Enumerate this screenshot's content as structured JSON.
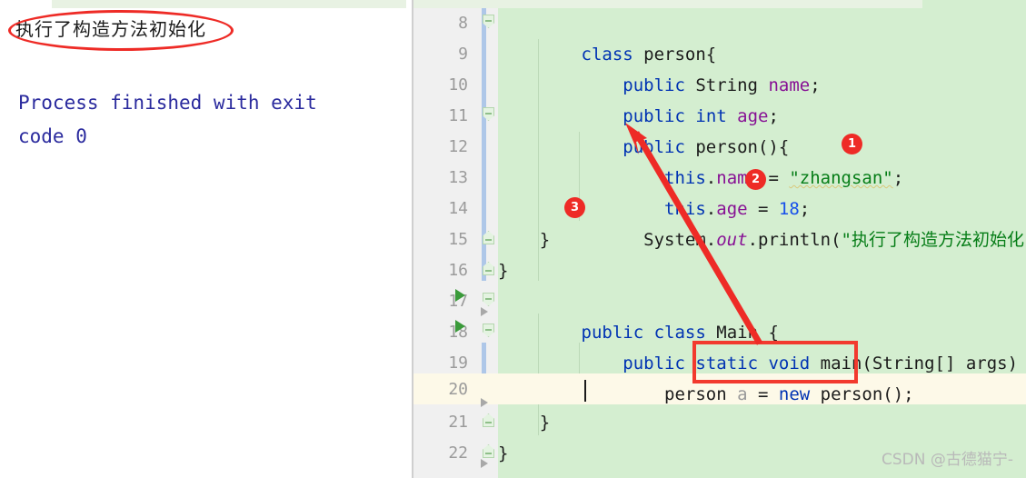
{
  "console": {
    "output_chinese": "执行了构造方法初始化",
    "exit_line1": "Process finished with exit",
    "exit_line2": "code 0"
  },
  "annotations": {
    "ellipse_label": "ellipse-highlight-console-output",
    "badge1": "1",
    "badge2": "2",
    "badge3": "3",
    "redbox_label": "red-box-new-person",
    "arrow_label": "red-arrow-pointing-to-constructor",
    "accent_red": "#ee2b26",
    "box_red": "#f23a2e"
  },
  "editor": {
    "background": "#d4eed0",
    "gutter_background": "#f0f0f0",
    "caret_line_background": "#fdf9e8",
    "lines": [
      {
        "number": "8",
        "text": "class person{",
        "tokens": [
          {
            "t": "class",
            "c": "kw"
          },
          {
            "t": " ",
            "c": "plain"
          },
          {
            "t": "person{",
            "c": "plain"
          }
        ]
      },
      {
        "number": "9",
        "text": "    public String name;",
        "tokens": [
          {
            "t": "    ",
            "c": "plain"
          },
          {
            "t": "public",
            "c": "kw"
          },
          {
            "t": " String ",
            "c": "plain"
          },
          {
            "t": "name",
            "c": "field"
          },
          {
            "t": ";",
            "c": "plain"
          }
        ]
      },
      {
        "number": "10",
        "text": "    public int age;",
        "tokens": [
          {
            "t": "    ",
            "c": "plain"
          },
          {
            "t": "public",
            "c": "kw"
          },
          {
            "t": " ",
            "c": "plain"
          },
          {
            "t": "int",
            "c": "kw"
          },
          {
            "t": " ",
            "c": "plain"
          },
          {
            "t": "age",
            "c": "field"
          },
          {
            "t": ";",
            "c": "plain"
          }
        ]
      },
      {
        "number": "11",
        "text": "    public person(){",
        "tokens": [
          {
            "t": "    ",
            "c": "plain"
          },
          {
            "t": "public",
            "c": "kw"
          },
          {
            "t": " person(){",
            "c": "plain"
          }
        ]
      },
      {
        "number": "12",
        "text": "        this.name = \"zhangsan\";",
        "tokens": [
          {
            "t": "        ",
            "c": "plain"
          },
          {
            "t": "this",
            "c": "kw"
          },
          {
            "t": ".",
            "c": "plain"
          },
          {
            "t": "name",
            "c": "field"
          },
          {
            "t": " = ",
            "c": "plain"
          },
          {
            "t": "\"zhangsan\"",
            "c": "str wavy"
          },
          {
            "t": ";",
            "c": "plain"
          }
        ]
      },
      {
        "number": "13",
        "text": "        this.age = 18;",
        "tokens": [
          {
            "t": "        ",
            "c": "plain"
          },
          {
            "t": "this",
            "c": "kw"
          },
          {
            "t": ".",
            "c": "plain"
          },
          {
            "t": "age",
            "c": "field"
          },
          {
            "t": " = ",
            "c": "plain"
          },
          {
            "t": "18",
            "c": "num"
          },
          {
            "t": ";",
            "c": "plain"
          }
        ]
      },
      {
        "number": "14",
        "text": "      System.out.println(\"执行了构造方法初始化\");",
        "tokens": [
          {
            "t": "      System.",
            "c": "plain"
          },
          {
            "t": "out",
            "c": "static-it"
          },
          {
            "t": ".println(",
            "c": "plain"
          },
          {
            "t": "\"执行了构造方法初始化\"",
            "c": "str"
          },
          {
            "t": ");",
            "c": "plain"
          }
        ]
      },
      {
        "number": "15",
        "text": "    }",
        "tokens": [
          {
            "t": "    }",
            "c": "plain"
          }
        ]
      },
      {
        "number": "16",
        "text": "}",
        "tokens": [
          {
            "t": "}",
            "c": "plain"
          }
        ]
      },
      {
        "number": "17",
        "text": "public class Main {",
        "tokens": [
          {
            "t": "public",
            "c": "kw"
          },
          {
            "t": " ",
            "c": "plain"
          },
          {
            "t": "class",
            "c": "kw"
          },
          {
            "t": " Main {",
            "c": "plain"
          }
        ]
      },
      {
        "number": "18",
        "text": "    public static void main(String[] args) {",
        "tokens": [
          {
            "t": "    ",
            "c": "plain"
          },
          {
            "t": "public",
            "c": "kw"
          },
          {
            "t": " ",
            "c": "plain"
          },
          {
            "t": "static",
            "c": "kw"
          },
          {
            "t": " ",
            "c": "plain"
          },
          {
            "t": "void",
            "c": "kw"
          },
          {
            "t": " main(String[] args) {",
            "c": "plain"
          }
        ]
      },
      {
        "number": "19",
        "text": "        person a = new person();",
        "tokens": [
          {
            "t": "        person ",
            "c": "plain"
          },
          {
            "t": "a",
            "c": "unused"
          },
          {
            "t": " = ",
            "c": "plain"
          },
          {
            "t": "new",
            "c": "kw"
          },
          {
            "t": " person();",
            "c": "plain"
          }
        ]
      },
      {
        "number": "20",
        "text": "        ",
        "tokens": [
          {
            "t": "",
            "c": "plain"
          }
        ]
      },
      {
        "number": "21",
        "text": "    }",
        "tokens": [
          {
            "t": "    }",
            "c": "plain"
          }
        ]
      },
      {
        "number": "22",
        "text": "}",
        "tokens": [
          {
            "t": "}",
            "c": "plain"
          }
        ]
      }
    ]
  },
  "watermark": {
    "text": "CSDN @古德猫宁-"
  }
}
